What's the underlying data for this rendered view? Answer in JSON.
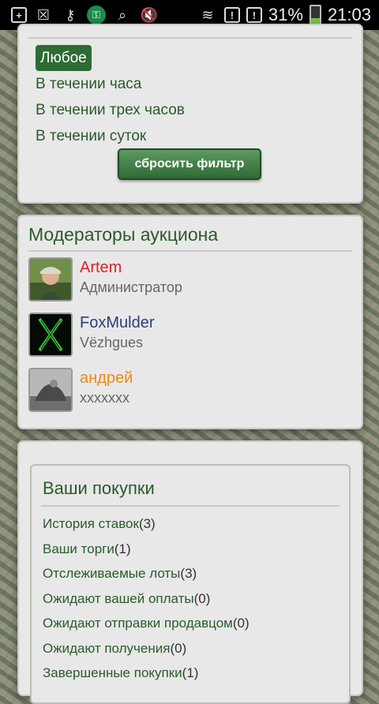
{
  "status_bar": {
    "battery": "31%",
    "time": "21:03",
    "battery_level": 0.31
  },
  "filter": {
    "options": [
      "Любое",
      "В течении часа",
      "В течении трех часов",
      "В течении суток"
    ],
    "selected_index": 0,
    "reset_label": "сбросить фильтр"
  },
  "moderators": {
    "title": "Модераторы аукциона",
    "items": [
      {
        "name": "Artem",
        "role": "Администратор",
        "name_color": "#e02020",
        "avatar": "person-photo"
      },
      {
        "name": "FoxMulder",
        "role": "Vëzhgues",
        "name_color": "#2a3f7a",
        "avatar": "x-files-logo"
      },
      {
        "name": "андрей",
        "role": "xxxxxxx",
        "name_color": "#e88a1a",
        "avatar": "grey-photo"
      }
    ]
  },
  "purchases": {
    "title": "Ваши покупки",
    "items": [
      {
        "label": "История ставок",
        "count": "(3)"
      },
      {
        "label": "Ваши торги",
        "count": "(1)"
      },
      {
        "label": "Отслеживаемые лоты",
        "count": "(3)"
      },
      {
        "label": "Ожидают вашей оплаты",
        "count": "(0)"
      },
      {
        "label": "Ожидают отправки продавцом",
        "count": "(0)"
      },
      {
        "label": "Ожидают получения",
        "count": "(0)"
      },
      {
        "label": "Завершенные покупки",
        "count": "(1)"
      }
    ]
  },
  "colors": {
    "accent_green": "#2e6b34",
    "text_green": "#2b5a2b",
    "panel_bg": "#e8e8e8"
  }
}
